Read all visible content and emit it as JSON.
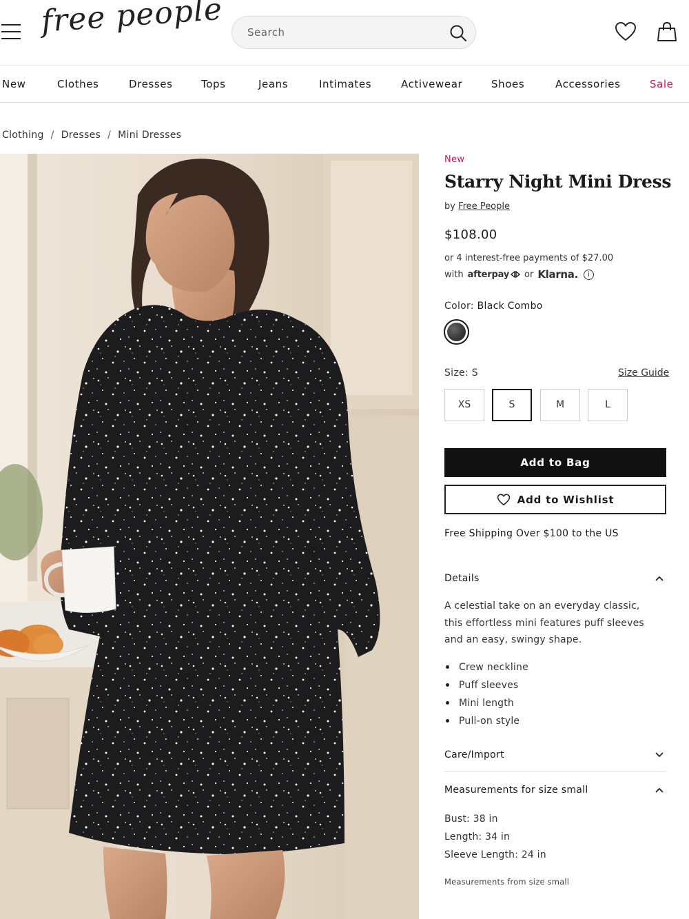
{
  "header": {
    "logo_text": "free people",
    "search": {
      "placeholder": "Search",
      "value": ""
    },
    "icons": [
      "hamburger-menu-icon",
      "search-icon",
      "heart-icon",
      "shopping-bag-icon"
    ]
  },
  "nav": {
    "items": [
      {
        "label": "New"
      },
      {
        "label": "Clothes"
      },
      {
        "label": "Dresses"
      },
      {
        "label": "Tops"
      },
      {
        "label": "Jeans"
      },
      {
        "label": "Intimates"
      },
      {
        "label": "Activewear"
      },
      {
        "label": "Shoes"
      },
      {
        "label": "Accessories"
      },
      {
        "label": "Sale"
      }
    ],
    "sale_color": "#c2185b"
  },
  "breadcrumb": {
    "items": [
      "Clothing",
      "Dresses",
      "Mini Dresses"
    ],
    "separator": "/"
  },
  "product": {
    "badge": "New",
    "badge_color": "#c2185b",
    "title": "Starry Night Mini Dress",
    "by_prefix": "by",
    "brand": "Free People",
    "price": "$108.00",
    "installments_line": "or 4 interest-free payments of $27.00",
    "with_text": "with",
    "afterpay": "afterpay",
    "or_text": "or",
    "klarna": "Klarna.",
    "info_icon": "i",
    "color_label": "Color:",
    "color_value": "Black Combo",
    "size_label": "Size:",
    "size_value": "S",
    "size_guide": "Size Guide",
    "sizes": [
      "XS",
      "S",
      "M",
      "L"
    ],
    "selected_size": "S",
    "add_to_bag": "Add to Bag",
    "add_to_wishlist": "Add to Wishlist",
    "shipping": "Free Shipping Over $100 to the US"
  },
  "details": {
    "label": "Details",
    "expanded": true,
    "description": "A celestial take on an everyday classic, this effortless mini features puff sleeves and an easy, swingy shape.",
    "features": [
      "Crew neckline",
      "Puff sleeves",
      "Mini length",
      "Pull-on style"
    ]
  },
  "care": {
    "label": "Care/Import",
    "expanded": false
  },
  "measurements": {
    "label": "Measurements for size small",
    "expanded": true,
    "lines": [
      "Bust: 38 in",
      "Length: 34 in",
      "Sleeve Length: 24 in"
    ],
    "note": "Measurements from size small"
  }
}
